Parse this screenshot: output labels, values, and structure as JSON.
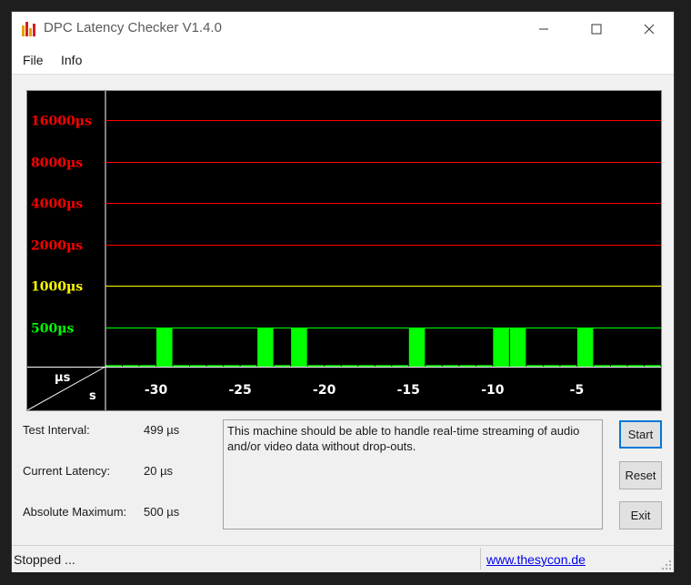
{
  "window": {
    "title": "DPC Latency Checker V1.4.0"
  },
  "menu": {
    "file": "File",
    "info": "Info"
  },
  "chart_data": {
    "type": "bar",
    "y_scale": "log2",
    "y_tick_labels": [
      "16000µs",
      "8000µs",
      "4000µs",
      "2000µs",
      "1000µs",
      "500µs"
    ],
    "y_tick_values": [
      16000,
      8000,
      4000,
      2000,
      1000,
      500
    ],
    "y_tick_colors": [
      "#ff0000",
      "#ff0000",
      "#ff0000",
      "#ff0000",
      "#ffff00",
      "#00ff00"
    ],
    "x_tick_labels": [
      "-30",
      "-25",
      "-20",
      "-15",
      "-10",
      "-5"
    ],
    "x_tick_values": [
      -30,
      -25,
      -20,
      -15,
      -10,
      -5
    ],
    "xlim": [
      -33,
      0
    ],
    "corner_y_unit": "µs",
    "corner_x_unit": "s",
    "bar_color": "#00ff00",
    "samples": [
      {
        "x": -32.5,
        "value": 20
      },
      {
        "x": -31.5,
        "value": 20
      },
      {
        "x": -30.5,
        "value": 20
      },
      {
        "x": -29.5,
        "value": 500
      },
      {
        "x": -28.5,
        "value": 20
      },
      {
        "x": -27.5,
        "value": 20
      },
      {
        "x": -26.5,
        "value": 20
      },
      {
        "x": -25.5,
        "value": 20
      },
      {
        "x": -24.5,
        "value": 20
      },
      {
        "x": -23.5,
        "value": 500
      },
      {
        "x": -22.5,
        "value": 20
      },
      {
        "x": -21.5,
        "value": 500
      },
      {
        "x": -20.5,
        "value": 20
      },
      {
        "x": -19.5,
        "value": 20
      },
      {
        "x": -18.5,
        "value": 20
      },
      {
        "x": -17.5,
        "value": 20
      },
      {
        "x": -16.5,
        "value": 20
      },
      {
        "x": -15.5,
        "value": 20
      },
      {
        "x": -14.5,
        "value": 500
      },
      {
        "x": -13.5,
        "value": 20
      },
      {
        "x": -12.5,
        "value": 20
      },
      {
        "x": -11.5,
        "value": 20
      },
      {
        "x": -10.5,
        "value": 20
      },
      {
        "x": -9.5,
        "value": 500
      },
      {
        "x": -8.5,
        "value": 500
      },
      {
        "x": -7.5,
        "value": 20
      },
      {
        "x": -6.5,
        "value": 20
      },
      {
        "x": -5.5,
        "value": 20
      },
      {
        "x": -4.5,
        "value": 500
      },
      {
        "x": -3.5,
        "value": 20
      },
      {
        "x": -2.5,
        "value": 20
      },
      {
        "x": -1.5,
        "value": 20
      },
      {
        "x": -0.5,
        "value": 20
      }
    ]
  },
  "stats": {
    "test_interval_label": "Test Interval:",
    "test_interval_value": "499 µs",
    "current_latency_label": "Current Latency:",
    "current_latency_value": "20 µs",
    "absolute_maximum_label": "Absolute Maximum:",
    "absolute_maximum_value": "500 µs"
  },
  "message": "This machine should be able to handle real-time streaming of audio and/or video data without drop-outs.",
  "buttons": {
    "start": "Start",
    "reset": "Reset",
    "exit": "Exit"
  },
  "status": {
    "text": "Stopped ...",
    "link": "www.thesycon.de"
  }
}
